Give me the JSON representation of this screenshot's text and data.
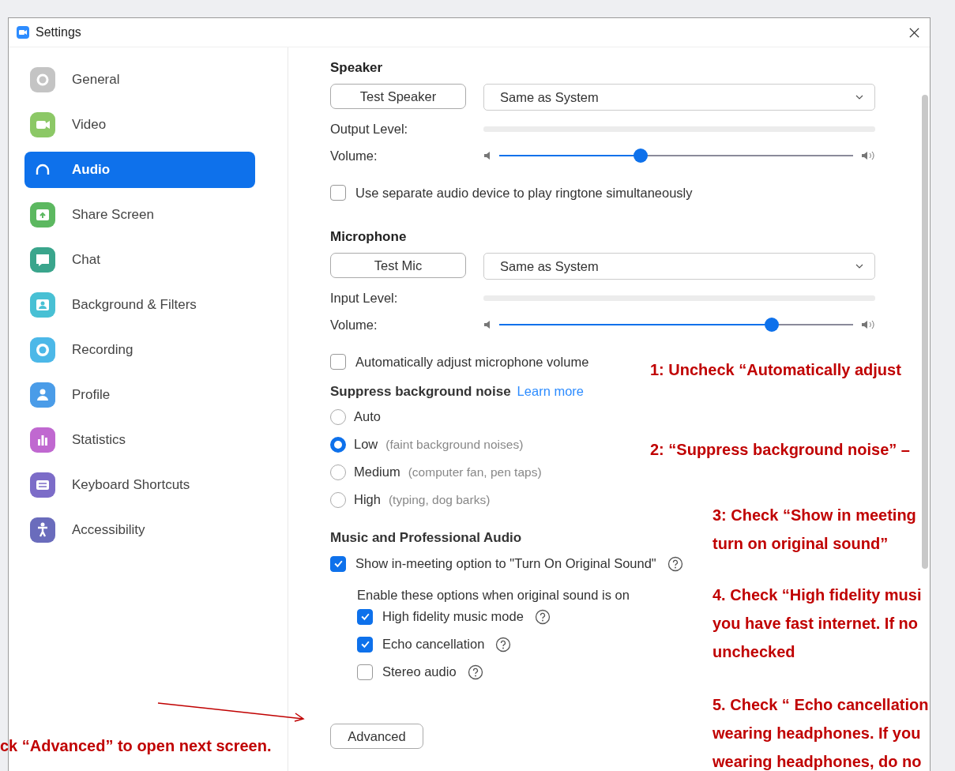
{
  "window": {
    "title": "Settings"
  },
  "sidebar": {
    "items": [
      {
        "label": "General",
        "selected": false,
        "color": "#c4c4c4"
      },
      {
        "label": "Video",
        "selected": false,
        "color": "#8cc866"
      },
      {
        "label": "Audio",
        "selected": true,
        "color": "#ffffff"
      },
      {
        "label": "Share Screen",
        "selected": false,
        "color": "#5cb860"
      },
      {
        "label": "Chat",
        "selected": false,
        "color": "#3aa58c"
      },
      {
        "label": "Background & Filters",
        "selected": false,
        "color": "#48c0d4"
      },
      {
        "label": "Recording",
        "selected": false,
        "color": "#4cb8e8"
      },
      {
        "label": "Profile",
        "selected": false,
        "color": "#4a9ce8"
      },
      {
        "label": "Statistics",
        "selected": false,
        "color": "#c068d0"
      },
      {
        "label": "Keyboard Shortcuts",
        "selected": false,
        "color": "#7c6cc8"
      },
      {
        "label": "Accessibility",
        "selected": false,
        "color": "#6a6cbc"
      }
    ]
  },
  "speaker": {
    "heading": "Speaker",
    "test_button": "Test Speaker",
    "device": "Same as System",
    "level_label": "Output Level:",
    "volume_label": "Volume:",
    "volume": {
      "level": 0.4
    },
    "separate_device": {
      "label": "Use separate audio device to play ringtone simultaneously",
      "checked": false
    }
  },
  "microphone": {
    "heading": "Microphone",
    "test_button": "Test Mic",
    "device": "Same as System",
    "level_label": "Input Level:",
    "volume_label": "Volume:",
    "volume": {
      "level": 0.77
    },
    "auto_adjust": {
      "label": "Automatically adjust microphone volume",
      "checked": false
    }
  },
  "suppress": {
    "heading": "Suppress background noise",
    "link": "Learn more",
    "options": [
      {
        "label": "Auto",
        "selected": false
      },
      {
        "label": "Low",
        "hint": "(faint background noises)",
        "selected": true
      },
      {
        "label": "Medium",
        "hint": "(computer fan, pen taps)",
        "selected": false
      },
      {
        "label": "High",
        "hint": "(typing, dog barks)",
        "selected": false
      }
    ]
  },
  "music": {
    "heading": "Music and Professional Audio",
    "original_sound": {
      "label": "Show in-meeting option to \"Turn On Original Sound\"",
      "checked": true
    },
    "sub_heading": "Enable these options when original sound is on",
    "options": [
      {
        "label": "High fidelity music mode",
        "checked": true
      },
      {
        "label": "Echo cancellation",
        "checked": true
      },
      {
        "label": "Stereo audio",
        "checked": false
      }
    ]
  },
  "advanced_button": "Advanced",
  "annotations": [
    {
      "lines": [
        "1:  Uncheck “Automatically adjust"
      ]
    },
    {
      "lines": [
        "2:  “Suppress background noise” –"
      ]
    },
    {
      "lines": [
        "3:  Check “Show in meeting",
        "turn on original sound”"
      ]
    },
    {
      "lines": [
        "4.  Check “High fidelity musi",
        "you have fast internet.  If no",
        "unchecked"
      ]
    },
    {
      "lines": [
        "5. Check “ Echo cancellation",
        "wearing headphones.  If you",
        "wearing headphones, do no"
      ]
    },
    {
      "lines": [
        "ck “Advanced” to open next screen."
      ]
    }
  ]
}
